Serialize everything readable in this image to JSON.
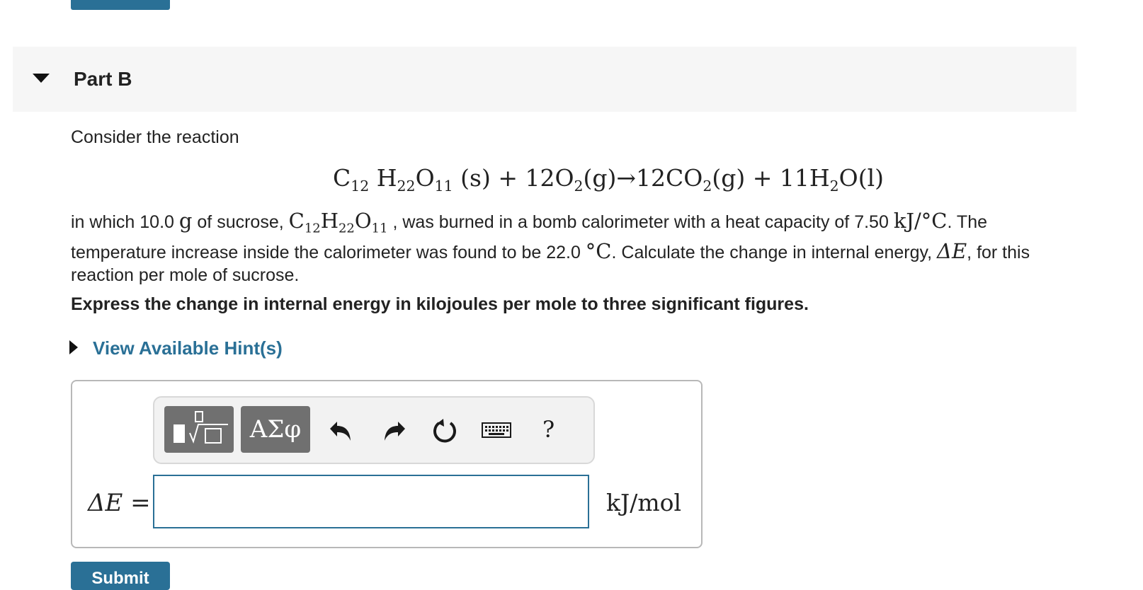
{
  "part": {
    "title": "Part B"
  },
  "question": {
    "intro": "Consider the reaction",
    "equation": {
      "c12": "C",
      "c12_sub": "12",
      "h22": "H",
      "h22_sub": "22",
      "o11": "O",
      "o11_sub": "11",
      "state_s": "(s) + 12O",
      "o2_sub": "2",
      "state_g_arrow": "(g)→12CO",
      "co2_sub": "2",
      "state_g_plus": "(g) + 11H",
      "h2_sub": "2",
      "tail": "O(l)"
    },
    "text_parts": {
      "p1": "in which 10.0 ",
      "g_unit": "g",
      "p2": " of sucrose, ",
      "p3": " , was burned in a bomb calorimeter with a heat capacity of 7.50 ",
      "kj_per_c": "kJ/°C",
      "p4": ". The temperature increase inside the calorimeter was found to be 22.0 ",
      "deg_c": "°C",
      "p5": ". Calculate the change in internal energy, ",
      "delta_e": "ΔE",
      "p6": ", for this reaction per mole of sucrose."
    },
    "instruction": "Express the change in internal energy in kilojoules per mole to three significant figures.",
    "hint_link": "View Available Hint(s)"
  },
  "answer": {
    "symbols_label": "ΑΣφ",
    "help_label": "?",
    "variable_label": "ΔE =",
    "input_value": "",
    "unit": "kJ/mol",
    "submit_label": "Submit"
  },
  "colors": {
    "accent": "#2a7096",
    "tool_button": "#707070",
    "header_bg": "#f6f6f6"
  }
}
